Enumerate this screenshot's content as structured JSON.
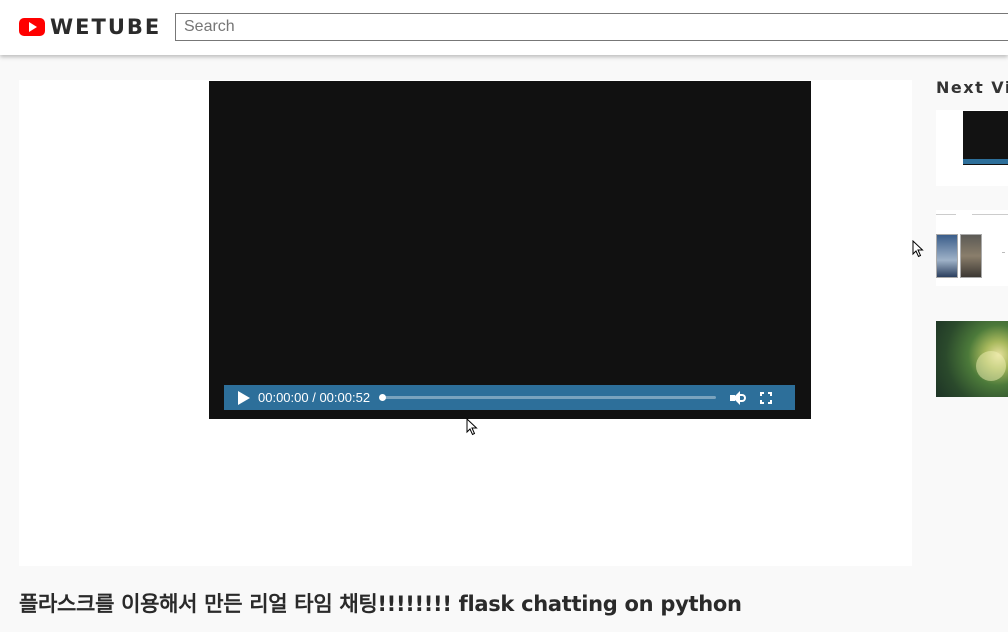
{
  "header": {
    "logo_text": "WETUBE",
    "logo_icon": "play-logo-icon",
    "search_placeholder": "Search"
  },
  "player": {
    "current_time": "00:00:00",
    "duration": "00:00:52",
    "time_label": "00:00:00 / 00:00:52",
    "progress": 0,
    "controls_color": "#2d6f9a",
    "icons": [
      "play-icon",
      "volume-icon",
      "fullscreen-icon"
    ]
  },
  "video": {
    "title": "플라스크를 이용해서 만든 리얼 타임 채팅!!!!!!!! flask chatting on python"
  },
  "sidebar": {
    "title": "Next Vid"
  },
  "colors": {
    "logo_red": "#ff0000",
    "page_bg": "#f9f9f9",
    "video_bg": "#111111"
  }
}
